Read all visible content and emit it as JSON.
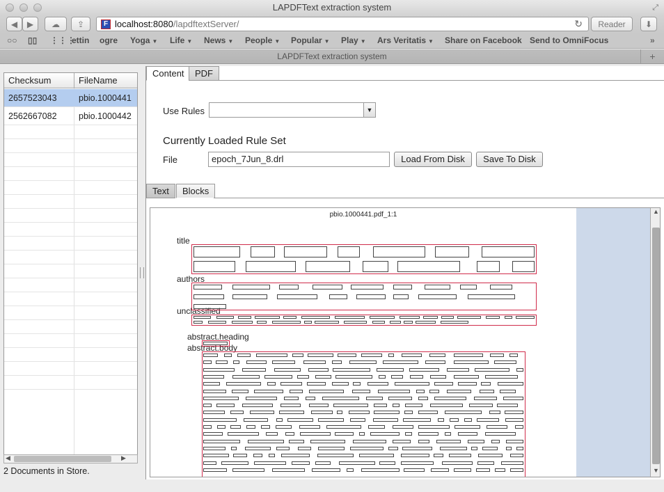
{
  "window": {
    "title": "LAPDFText extraction system"
  },
  "toolbar": {
    "url_host": "localhost:8080",
    "url_path": "/lapdftextServer/",
    "reader_label": "Reader",
    "url_icon_letter": "F"
  },
  "bookmarks": [
    {
      "label": "ettin",
      "dropdown": false
    },
    {
      "label": "ogre",
      "dropdown": false
    },
    {
      "label": "Yoga",
      "dropdown": true
    },
    {
      "label": "Life",
      "dropdown": true
    },
    {
      "label": "News",
      "dropdown": true
    },
    {
      "label": "People",
      "dropdown": true
    },
    {
      "label": "Popular",
      "dropdown": true
    },
    {
      "label": "Play",
      "dropdown": true
    },
    {
      "label": "Ars Veritatis",
      "dropdown": true
    },
    {
      "label": "Share on Facebook",
      "dropdown": false
    },
    {
      "label": "Send to OmniFocus",
      "dropdown": false
    }
  ],
  "tab": {
    "title": "LAPDFText extraction system"
  },
  "documents": {
    "columns": [
      "Checksum",
      "FileName"
    ],
    "rows": [
      {
        "checksum": "2657523043",
        "filename": "pbio.1000441",
        "selected": true
      },
      {
        "checksum": "2562667082",
        "filename": "pbio.1000442",
        "selected": false
      }
    ],
    "status": "2 Documents in Store."
  },
  "main_tabs": {
    "content": "Content",
    "pdf": "PDF"
  },
  "rules": {
    "use_rules_label": "Use Rules",
    "use_rules_value": "",
    "heading": "Currently Loaded Rule Set",
    "file_label": "File",
    "file_value": "epoch_7Jun_8.drl",
    "load_button": "Load From Disk",
    "save_button": "Save To Disk"
  },
  "sub_tabs": {
    "text": "Text",
    "blocks": "Blocks"
  },
  "viewer": {
    "page_tag": "pbio.1000441.pdf_1:1",
    "block_labels": {
      "title": "title",
      "authors": "authors",
      "unclassified": "unclassified",
      "abstract_heading": "abstract.heading",
      "abstract_body": "abstract.body"
    }
  },
  "colors": {
    "selection": "#b4cdef",
    "zone_border": "#d02b4a",
    "viewer_side": "#cdd9ea"
  }
}
